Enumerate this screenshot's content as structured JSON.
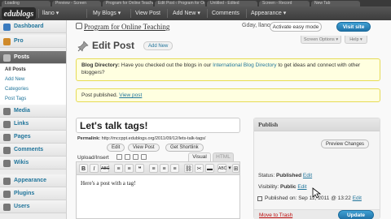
{
  "browser_tabs": [
    "Loading",
    "Preview - Screen",
    "Program for Online Teaching",
    "Edit Post ‹ Program for Online...",
    "Untitled - Edited",
    "Screen - Record",
    "New Tab"
  ],
  "adminbar": {
    "logo": "edublogs",
    "user": "llano",
    "my_blogs": "My Blogs",
    "view_post": "View Post",
    "add_new": "Add New",
    "comments": "Comments",
    "appearance": "Appearance"
  },
  "sidebar": {
    "items": [
      {
        "label": "Dashboard",
        "color": "#3b7bbf"
      },
      {
        "label": "Pro",
        "color": "#d08a2a"
      },
      {
        "label": "Posts",
        "color": "#888888"
      },
      {
        "label": "Media",
        "color": "#6a6a6a"
      },
      {
        "label": "Links",
        "color": "#6a6a6a"
      },
      {
        "label": "Pages",
        "color": "#6a6a6a"
      },
      {
        "label": "Comments",
        "color": "#6a6a6a"
      },
      {
        "label": "Wikis",
        "color": "#6a6a6a"
      },
      {
        "label": "Appearance",
        "color": "#6a6a6a"
      },
      {
        "label": "Plugins",
        "color": "#6a6a6a"
      },
      {
        "label": "Users",
        "color": "#6a6a6a"
      }
    ],
    "posts_sub": [
      "All Posts",
      "Add New",
      "Categories",
      "Post Tags"
    ]
  },
  "header": {
    "site_name": "Program for Online Teaching",
    "howdy": "Gday, llano",
    "easy_mode": "Activate easy mode",
    "visit_site": "Visit site",
    "screen_options": "Screen Options ▾",
    "help": "Help ▾"
  },
  "page": {
    "title": "Edit Post",
    "add_new": "Add New"
  },
  "notice_directory": {
    "lead": "Blog Directory:",
    "text1": "Have you checked out the blogs in our",
    "link": "International Blog Directory",
    "text2": "to get ideas and connect with other bloggers?"
  },
  "notice_published": {
    "text": "Post published.",
    "link": "View post"
  },
  "post": {
    "title": "Let's talk tags!",
    "permalink_label": "Permalink:",
    "permalink_url": "http://mccppt.edublogs.org/2011/09/12/lets-talk-tags/",
    "edit": "Edit",
    "view_post": "View Post",
    "get_shortlink": "Get Shortlink",
    "upload_insert": "Upload/Insert",
    "tab_visual": "Visual",
    "tab_html": "HTML",
    "content": "Here's a post with a tag!"
  },
  "toolbar_buttons": [
    "B",
    "I",
    "ABC",
    "≡",
    "≡",
    "❝",
    "≡",
    "≡",
    "≡",
    "⛓",
    "✂",
    "▬",
    "ABC",
    "▾",
    "⊞"
  ],
  "publish": {
    "heading": "Publish",
    "preview_changes": "Preview Changes",
    "status_label": "Status:",
    "status_value": "Published",
    "status_edit": "Edit",
    "visibility_label": "Visibility:",
    "visibility_value": "Public",
    "visibility_edit": "Edit",
    "published_on": "Published on: Sep 12, 2011 @ 13:22",
    "published_edit": "Edit",
    "move_to_trash": "Move to Trash",
    "update": "Update"
  }
}
